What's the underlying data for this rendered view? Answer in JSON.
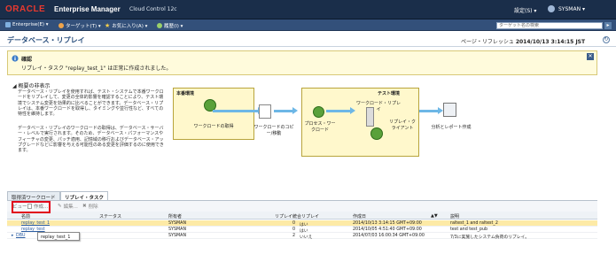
{
  "header": {
    "logo_text": "ORACLE",
    "product": "Enterprise Manager",
    "edition": "Cloud Control 12c",
    "setup_menu": "設定(S) ▾",
    "user_menu": "SYSMAN ▾"
  },
  "nav": {
    "items": [
      "Enterprise(E) ▾",
      "ターゲット(T) ▾",
      "お気に入り(A) ▾",
      "履歴(I) ▾"
    ],
    "search_placeholder": "ターゲット名の検索"
  },
  "page": {
    "title": "データベース・リプレイ",
    "refresh_label": "ページ・リフレッシュ",
    "refresh_time": "2014/10/13 3:14:15 JST"
  },
  "confirmation": {
    "title": "確認",
    "message": "リプレイ・タスク \"replay_test_1\" は正常に作成されました。"
  },
  "overview": {
    "heading": "概要の非表示",
    "paragraph1": "データベース・リプレイを使用すれば、テスト・システムで本番ワークロードをリプレイして、変更の全体的影響を確認することにより、テスト環境でシステム変更を効果的に比べることができます。データベース・リプレイは、本番ワークロードを取得し、タイミングや並行性など、すべての特性を維持します。",
    "paragraph2": "データベース・リプレイのワークロードの取得は、データベース・サーバー・レベルで実行されます。そのため、データベース・パフォーマンスやフィーチャの変更、パッチ適用、記憶域の移行およびデータベース・アップグレードなどに影響を与える可能性のある変更を評価するのに使用できます。"
  },
  "diagram": {
    "prod_env": "本番環境",
    "test_env": "テスト環境",
    "capture": "ワークロードの取得",
    "copy": "ワークロードのコピー/移動",
    "process": "プロセス・ワークロード",
    "replay": "ワークロード・リプレイ",
    "replay_client": "リプレイ・クライアント",
    "analysis": "分析とレポート作成"
  },
  "tabs": [
    "取得済ワークロード",
    "リプレイ・タスク"
  ],
  "toolbar": {
    "view": "ビュー ▾",
    "create": "作成...",
    "edit": "編集...",
    "delete": "削除"
  },
  "table": {
    "columns": [
      "名前",
      "ステータス",
      "所有者",
      "リプレイ",
      "統合リプレイ",
      "作成日",
      "説明"
    ],
    "rows": [
      {
        "name": "replay_test_1",
        "status": "",
        "owner": "SYSMAN",
        "replays": "0",
        "consolidated": "はい",
        "created": "2014/10/13 3:14:15 GMT+09:00",
        "desc": "raltest_1 and raltest_2"
      },
      {
        "name": "replay_test",
        "status": "",
        "owner": "SYSMAN",
        "replays": "0",
        "consolidated": "はい",
        "created": "2014/10/05 4:51:40 GMT+09:00",
        "desc": "test and test_pub"
      },
      {
        "name": "DBU",
        "status": "",
        "owner": "SYSMAN",
        "replays": "2",
        "consolidated": "いいえ",
        "created": "2014/07/03 16:00:34 GMT+09:00",
        "desc": "7/3に実施したシステム負荷のリプレイ。"
      }
    ],
    "tooltip": "replay_test_1"
  },
  "colors": {
    "accent": "#e0001a",
    "topbar": "#1a2e4a",
    "navbar": "#33507a"
  }
}
